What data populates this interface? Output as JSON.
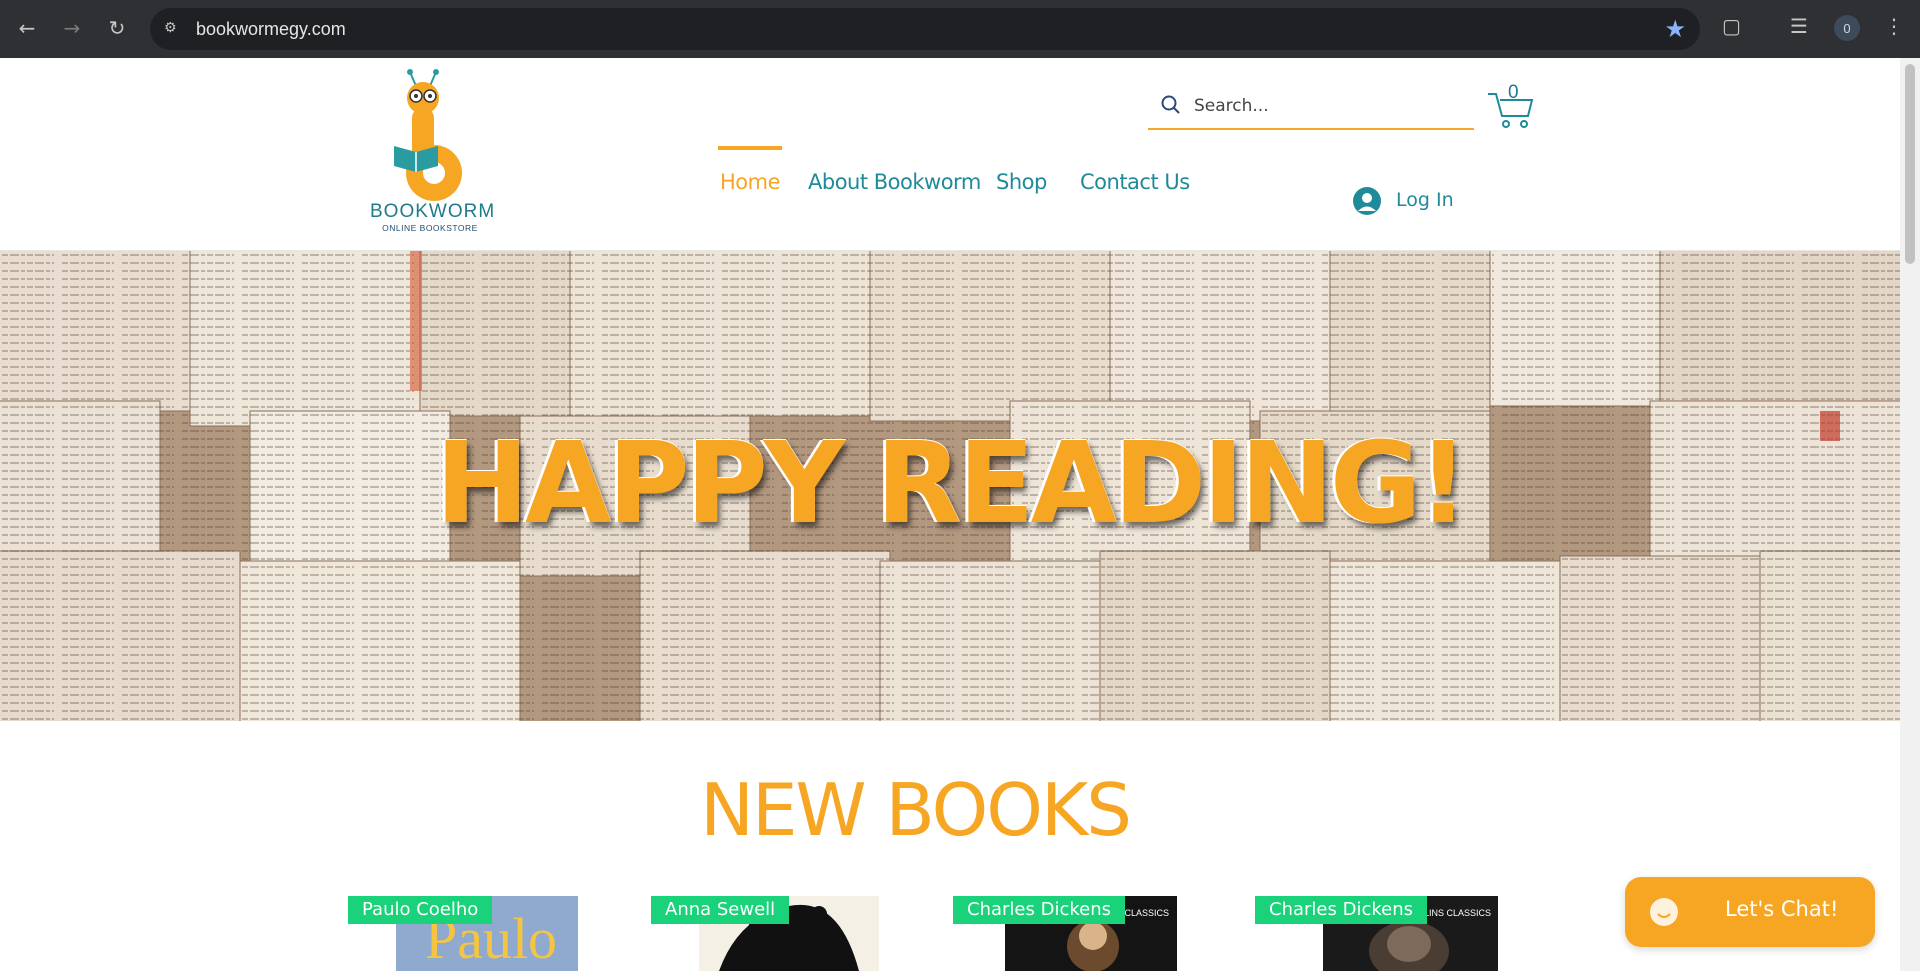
{
  "browser": {
    "url": "bookwormegy.com",
    "profile_initial": "0"
  },
  "logo": {
    "name": "BOOKWORM",
    "tagline": "ONLINE BOOKSTORE"
  },
  "search": {
    "placeholder": "Search..."
  },
  "cart": {
    "count": "0"
  },
  "nav": {
    "items": [
      {
        "label": "Home",
        "active": true
      },
      {
        "label": "About Bookworm",
        "active": false
      },
      {
        "label": "Shop",
        "active": false
      },
      {
        "label": "Contact Us",
        "active": false
      }
    ]
  },
  "login": {
    "label": "Log In"
  },
  "hero": {
    "title": "HAPPY READING!"
  },
  "new_books": {
    "title": "NEW BOOKS",
    "items": [
      {
        "author": "Paulo Coelho",
        "cover_text": "Paulo"
      },
      {
        "author": "Anna Sewell",
        "cover_text": ""
      },
      {
        "author": "Charles Dickens",
        "cover_text": "COLLINS CLASSICS"
      },
      {
        "author": "Charles Dickens",
        "cover_text": "COLLINS CLASSICS"
      }
    ]
  },
  "chat": {
    "label": "Let's Chat!"
  },
  "colors": {
    "accent": "#f6a623",
    "teal": "#1f8a9a",
    "tag_green": "#19d27a",
    "chrome_bg": "#2f3033"
  }
}
